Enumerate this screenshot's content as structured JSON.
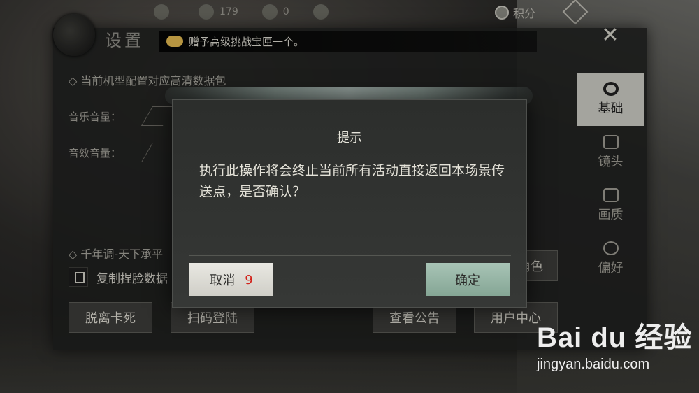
{
  "topbar": {
    "resource_1_value": "",
    "resource_2_value": "179",
    "resource_3_value": "0",
    "score_label": "积分"
  },
  "panel": {
    "title": "设置",
    "notice": "赠予高级挑战宝匣一个。",
    "section_hd_pack": "当前机型配置对应高清数据包",
    "music_volume_label": "音乐音量：",
    "sfx_volume_label": "音效音量：",
    "section_song": "千年调-天下承平",
    "copy_face_label": "复制捏脸数据",
    "role_button_partial": "角色",
    "buttons": {
      "unstuck": "脱离卡死",
      "scan_login": "扫码登陆",
      "view_notice": "查看公告",
      "user_center": "用户中心"
    }
  },
  "tabs": [
    {
      "label": "基础",
      "icon": "gear-icon",
      "active": true
    },
    {
      "label": "镜头",
      "icon": "camera-icon",
      "active": false
    },
    {
      "label": "画质",
      "icon": "monitor-icon",
      "active": false
    },
    {
      "label": "偏好",
      "icon": "user-settings-icon",
      "active": false
    }
  ],
  "modal": {
    "title": "提示",
    "message": "执行此操作将会终止当前所有活动直接返回本场景传送点，是否确认？",
    "cancel_label": "取消",
    "cancel_countdown": "9",
    "confirm_label": "确定"
  },
  "watermark": {
    "logo": "Bai du 经验",
    "url": "jingyan.baidu.com"
  }
}
